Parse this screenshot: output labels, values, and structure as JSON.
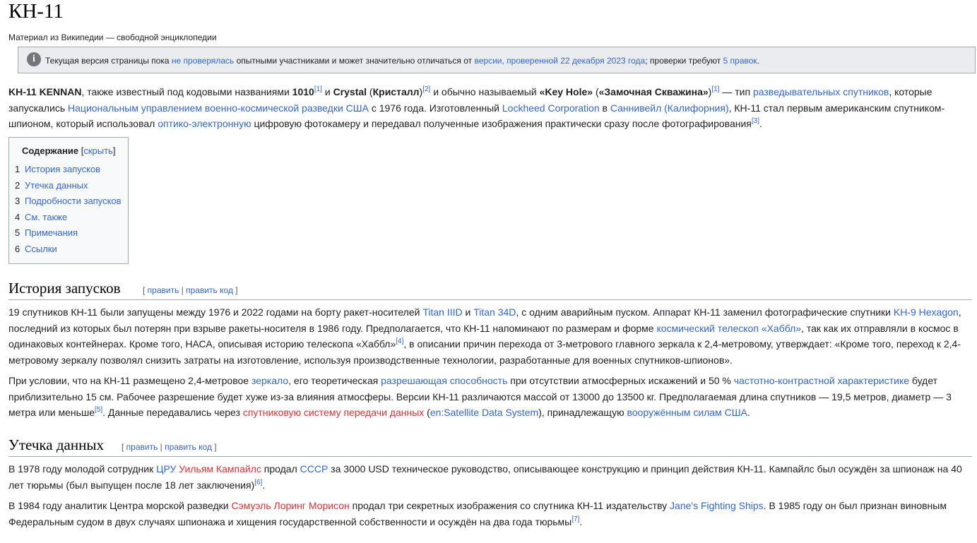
{
  "title": "КН-11",
  "tagline": "Материал из Википедии — свободной энциклопедии",
  "notice": {
    "t1": "Текущая версия страницы пока ",
    "l1": "не проверялась",
    "t2": " опытными участниками и может значительно отличаться от ",
    "l2": "версии, проверенной 22 декабря 2023 года",
    "t3": "; проверки требуют ",
    "l3": "5 правок",
    "t4": "."
  },
  "intro": {
    "b1": "KH-11 KENNAN",
    "t1": ", также известный под кодовыми названиями ",
    "b2": "1010",
    "r1": "[1]",
    "t2": " и ",
    "b3": "Crystal",
    "t3": " (",
    "b4": "Кристалл",
    "t4": ")",
    "r2": "[2]",
    "t5": " и обычно называемый ",
    "b5": "«Key Hole»",
    "t6": " (",
    "b6": "«Замочная Скважина»",
    "t7": ")",
    "r3": "[1]",
    "t8": " — тип ",
    "l1": "разведывательных спутников",
    "t9": ", которые запускались ",
    "l2": "Национальным управлением военно-космической разведки США",
    "t10": " с 1976 года. Изготовленный ",
    "l3": "Lockheed Corporation",
    "t11": " в ",
    "l4": "Саннивейл (Калифорния)",
    "t12": ", КН-11 стал первым американским спутником-шпионом, который использовал ",
    "l5": "оптико-электронную",
    "t13": " цифровую фотокамеру и передавал полученные изображения практически сразу после фотографирования",
    "r4": "[3]",
    "t14": "."
  },
  "toc": {
    "heading": "Содержание",
    "open": " [",
    "toggle": "скрыть",
    "close": "]",
    "items": [
      {
        "num": "1",
        "label": "История запусков"
      },
      {
        "num": "2",
        "label": "Утечка данных"
      },
      {
        "num": "3",
        "label": "Подробности запусков"
      },
      {
        "num": "4",
        "label": "См. также"
      },
      {
        "num": "5",
        "label": "Примечания"
      },
      {
        "num": "6",
        "label": "Ссылки"
      }
    ]
  },
  "edit": {
    "open": "[ ",
    "edit": "править",
    "sep": " | ",
    "edit_code": "править код",
    "close": " ]"
  },
  "history": {
    "heading": "История запусков",
    "p1": {
      "t1": "19 спутников КН-11 были запущены между 1976 и 2022 годами на борту ракет-носителей ",
      "l1": "Titan IIID",
      "t2": " и ",
      "l2": "Titan 34D",
      "t3": ", с одним аварийным пуском. Аппарат КН-11 заменил фотографические спутники ",
      "l3": "KH-9 Hexagon",
      "t4": ", последний из которых был потерян при взрыве ракеты-носителя в 1986 году. Предполагается, что КН-11 напоминают по размерам и форме ",
      "l4": "космический телескоп «Хаббл»",
      "t5": ", так как их отправляли в космос в одинаковых контейнерах. Кроме того, НАСА, описывая историю телескопа «Хаббл»",
      "r1": "[4]",
      "t6": ", в описании причин перехода от 3-метрового главного зеркала к 2,4-метровому, утверждает: «Кроме того, переход к 2,4-метровому зеркалу позволял снизить затраты на изготовление, используя производственные технологии, разработанные для военных спутников-шпионов»."
    },
    "p2": {
      "t1": "При условии, что на КН-11 размещено 2,4-метровое ",
      "l1": "зеркало",
      "t2": ", его теоретическая ",
      "l2": "разрешающая способность",
      "t3": " при отсутствии атмосферных искажений и 50 % ",
      "l3": "частотно-контрастной характеристике",
      "t4": " будет приблизительно 15 см. Рабочее разрешение будет хуже из-за влияния атмосферы. Версии КН-11 различаются массой от 13000 до 13500 кг. Предполагаемая длина спутников — 19,5 метров, диаметр — 3 метра или меньше",
      "r1": "[5]",
      "t5": ". Данные передавались через ",
      "l4": "спутниковую систему передачи данных",
      "t6": " (",
      "l5": "en:Satellite Data System",
      "t7": "), принадлежащую ",
      "l6": "вооружённым силам США",
      "t8": "."
    }
  },
  "leak": {
    "heading": "Утечка данных",
    "p1": {
      "t1": "В 1978 году молодой сотрудник ",
      "l1": "ЦРУ",
      "t2": " ",
      "l2": "Уильям Кампайлс",
      "t3": " продал ",
      "l3": "СССР",
      "t4": " за 3000 USD техническое руководство, описывающее конструкцию и принцип действия КН-11. Кампайлс был осуждён за шпионаж на 40 лет тюрьмы (был выпущен после 18 лет заключения)",
      "r1": "[6]",
      "t5": "."
    },
    "p2": {
      "t1": "В 1984 году аналитик Центра морской разведки ",
      "l1": "Сэмуэль Лоринг Морисон",
      "t2": " продал три секретных изображения со спутника КН-11 издательству ",
      "l2": "Jane's Fighting Ships",
      "t3": ". В 1985 году он был признан виновным Федеральным судом в двух случаях шпионажа и хищения государственной собственности и осуждён на два года тюрьмы",
      "r1": "[7]",
      "t4": "."
    }
  }
}
